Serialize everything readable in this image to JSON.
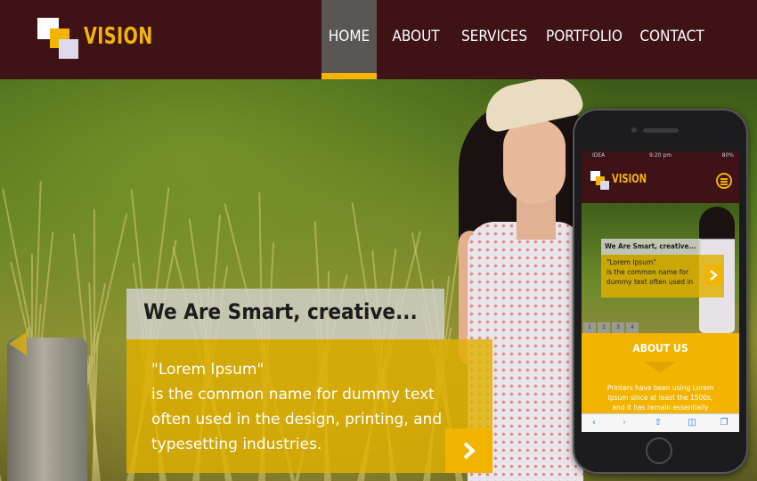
{
  "brand": {
    "name": "VISION",
    "logo_colors": [
      "#ffffff",
      "#f2b400",
      "#dcd9ec"
    ]
  },
  "nav": {
    "items": [
      {
        "label": "HOME",
        "active": true
      },
      {
        "label": "ABOUT",
        "active": false
      },
      {
        "label": "SERVICES",
        "active": false
      },
      {
        "label": "PORTFOLIO",
        "active": false
      },
      {
        "label": "CONTACT",
        "active": false
      }
    ]
  },
  "hero": {
    "title": "We Are Smart, creative...",
    "body": "\"Lorem Ipsum\"\nis the common name for dummy text\noften used in the design, printing, and\ntypesetting industries.",
    "next_icon": "chevron-right-icon"
  },
  "phone": {
    "status": {
      "carrier": "IDEA",
      "time": "9:20 pm",
      "battery": "80%"
    },
    "brand": "VISION",
    "menu_icon": "hamburger-menu-icon",
    "hero_title": "We Are Smart, creative...",
    "hero_body": "\"Lorem Ipsum\"\nis the common name for\ndummy text often used in",
    "pages": [
      "1",
      "2",
      "3",
      "4"
    ],
    "about_title": "ABOUT US",
    "about_body": "Printers have been using Lorem\nIpsum since at least the 1500s,\nand it has remain essentially",
    "toolbar_icons": [
      "back-icon",
      "forward-icon",
      "share-icon",
      "bookmarks-icon",
      "tabs-icon"
    ]
  },
  "colors": {
    "header_bg": "#3f1216",
    "accent": "#f2b400",
    "active_nav_bg": "#5a5653"
  }
}
